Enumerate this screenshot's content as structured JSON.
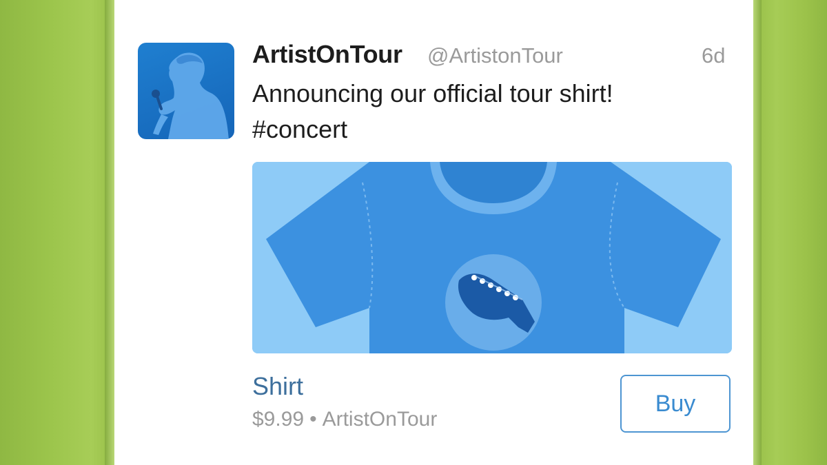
{
  "tweet": {
    "author_name": "ArtistOnTour",
    "author_handle": "@ArtistonTour",
    "time_ago": "6d",
    "text_line1": "Announcing our official tour shirt!",
    "text_line2": "#concert"
  },
  "product": {
    "name": "Shirt",
    "price": "$9.99",
    "separator": "•",
    "seller": "ArtistOnTour",
    "buy_label": "Buy"
  },
  "icons": {
    "avatar": "singer-silhouette-icon",
    "media": "tshirt-guitar-image"
  },
  "colors": {
    "background_green": "#9cc24a",
    "avatar_blue": "#1565b8",
    "shirt_blue": "#3c91e0",
    "media_background": "#8ecbf7",
    "buy_accent": "#3a8bd0",
    "product_name": "#3d6f9c"
  }
}
